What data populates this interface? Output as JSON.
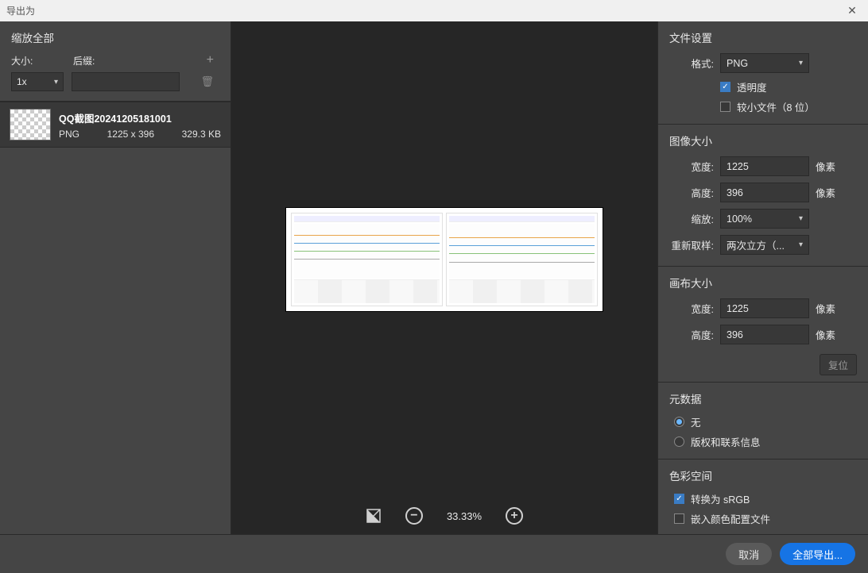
{
  "window": {
    "title": "导出为"
  },
  "leftPanel": {
    "scaleAll": "缩放全部",
    "sizeLabel": "大小:",
    "suffixLabel": "后缀:",
    "sizeValue": "1x",
    "asset": {
      "name": "QQ截图20241205181001",
      "format": "PNG",
      "dimensions": "1225 x 396",
      "filesize": "329.3 KB"
    }
  },
  "center": {
    "zoom": "33.33%"
  },
  "rightPanel": {
    "fileSettings": {
      "title": "文件设置",
      "formatLabel": "格式:",
      "formatValue": "PNG",
      "transparencyLabel": "透明度",
      "smallerLabel": "较小文件（8 位）"
    },
    "imageSize": {
      "title": "图像大小",
      "widthLabel": "宽度:",
      "widthValue": "1225",
      "heightLabel": "高度:",
      "heightValue": "396",
      "scaleLabel": "缩放:",
      "scaleValue": "100%",
      "resampleLabel": "重新取样:",
      "resampleValue": "两次立方（...",
      "unit": "像素"
    },
    "canvasSize": {
      "title": "画布大小",
      "widthLabel": "宽度:",
      "widthValue": "1225",
      "heightLabel": "高度:",
      "heightValue": "396",
      "unit": "像素",
      "reset": "复位"
    },
    "metadata": {
      "title": "元数据",
      "none": "无",
      "copyright": "版权和联系信息"
    },
    "colorSpace": {
      "title": "色彩空间",
      "convert": "转换为 sRGB",
      "embed": "嵌入颜色配置文件"
    }
  },
  "footer": {
    "cancel": "取消",
    "exportAll": "全部导出..."
  }
}
